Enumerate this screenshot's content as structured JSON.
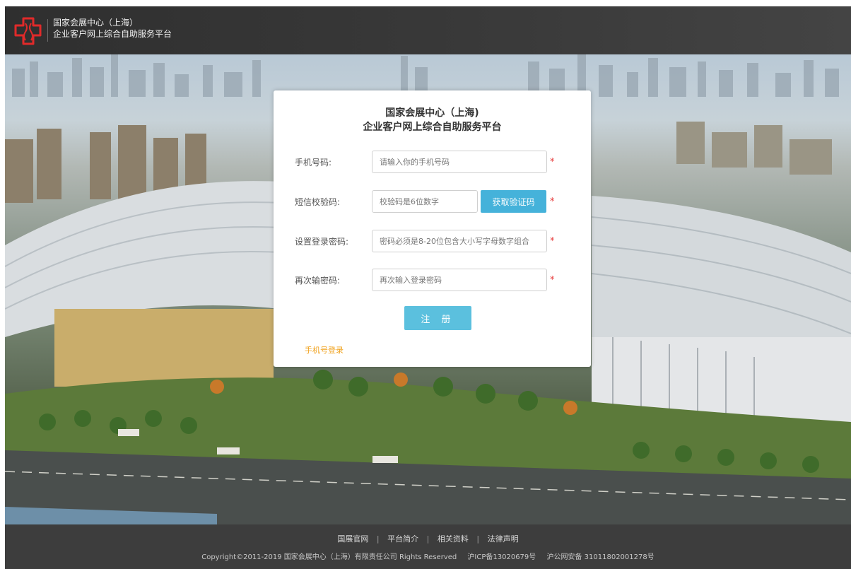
{
  "header": {
    "title_line1": "国家会展中心（上海）",
    "title_line2": "企业客户网上综合自助服务平台",
    "logo_icon": "center-logo-icon"
  },
  "card": {
    "title_line1": "国家会展中心（上海)",
    "title_line2": "企业客户网上综合自助服务平台",
    "fields": {
      "phone": {
        "label": "手机号码:",
        "placeholder": "请输入你的手机号码",
        "required": "*"
      },
      "sms": {
        "label": "短信校验码:",
        "placeholder": "校验码是6位数字",
        "button": "获取验证码",
        "required": "*"
      },
      "password": {
        "label": "设置登录密码:",
        "placeholder": "密码必须是8-20位包含大小写字母数字组合",
        "required": "*"
      },
      "confirm": {
        "label": "再次输密码:",
        "placeholder": "再次输入登录密码",
        "required": "*"
      }
    },
    "register_button": "注 册",
    "login_link": "手机号登录"
  },
  "footer": {
    "links": [
      "国展官网",
      "平台简介",
      "相关资料",
      "法律声明"
    ],
    "separator": "|",
    "copyright": "Copyright©2011-2019 国家会展中心（上海）有限责任公司 Rights Reserved",
    "icp": "沪ICP备13020679号",
    "police": "沪公网安备 31011802001278号"
  },
  "colors": {
    "header_bg": "#333333",
    "sms_button": "#45b2da",
    "register_button": "#5bc0de",
    "required_star": "#e63b3b",
    "login_link": "#f0a21e",
    "footer_bg": "#3d3d3d"
  }
}
